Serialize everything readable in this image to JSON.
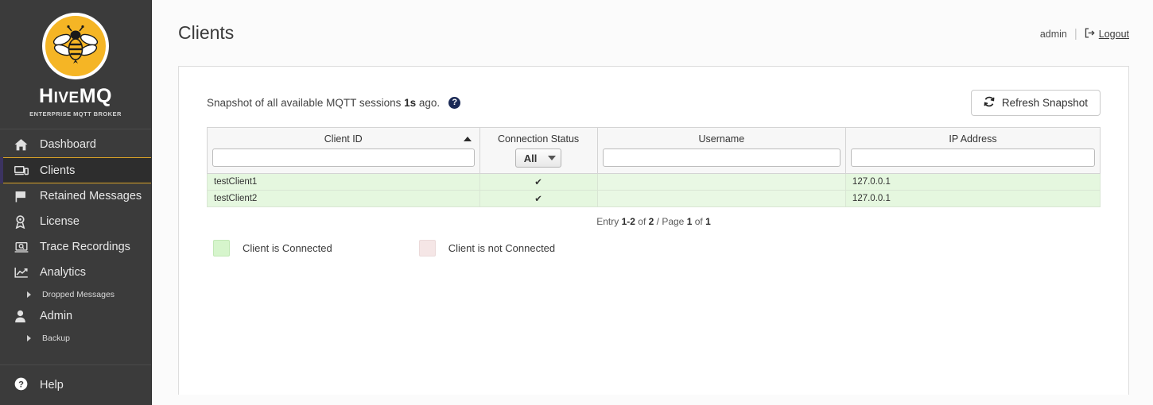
{
  "brand": {
    "logo_icon": "bee-logo-icon",
    "wordmark": "HiveMQ",
    "tagline": "ENTERPRISE MQTT BROKER",
    "logo_bg": "#f5b525"
  },
  "sidebar": {
    "items": [
      {
        "label": "Dashboard",
        "icon": "home-icon",
        "active": false
      },
      {
        "label": "Clients",
        "icon": "devices-icon",
        "active": true
      },
      {
        "label": "Retained Messages",
        "icon": "flag-icon",
        "active": false
      },
      {
        "label": "License",
        "icon": "award-icon",
        "active": false
      },
      {
        "label": "Trace Recordings",
        "icon": "laptop-search-icon",
        "active": false
      },
      {
        "label": "Analytics",
        "icon": "chart-line-icon",
        "active": false
      }
    ],
    "analytics_sub": {
      "label": "Dropped Messages",
      "icon": "caret-right-icon"
    },
    "admin": {
      "label": "Admin",
      "icon": "user-icon"
    },
    "admin_sub": {
      "label": "Backup",
      "icon": "caret-right-icon"
    },
    "help": {
      "label": "Help",
      "icon": "question-circle-icon"
    },
    "active_accent": "#d9a227"
  },
  "header": {
    "title": "Clients",
    "user": "admin",
    "divider": "|",
    "logout_label": "Logout",
    "logout_icon": "sign-out-icon"
  },
  "snapshot": {
    "text_before": "Snapshot of all available MQTT sessions ",
    "elapsed": "1s",
    "text_after": " ago.",
    "help_icon": "question-mark-icon",
    "refresh_label": "Refresh Snapshot",
    "refresh_icon": "refresh-icon"
  },
  "table": {
    "columns": [
      {
        "label": "Client ID",
        "sort": "asc",
        "filter_type": "text",
        "filter_value": ""
      },
      {
        "label": "Connection Status",
        "filter_type": "select",
        "filter_value": "All"
      },
      {
        "label": "Username",
        "filter_type": "text",
        "filter_value": ""
      },
      {
        "label": "IP Address",
        "filter_type": "text",
        "filter_value": ""
      }
    ],
    "rows": [
      {
        "client_id": "testClient1",
        "status": "✔",
        "username": "",
        "ip": "127.0.0.1",
        "connected": true
      },
      {
        "client_id": "testClient2",
        "status": "✔",
        "username": "",
        "ip": "127.0.0.1",
        "connected": true
      }
    ]
  },
  "pagination": {
    "entry_word": "Entry ",
    "entry_range": "1-2",
    "of_word": " of ",
    "total": "2",
    "page_word": " / Page ",
    "page_current": "1",
    "page_of_word": " of ",
    "page_total": "1"
  },
  "legend": {
    "connected_label": "Client is Connected",
    "connected_color": "#d6f5cc",
    "disconnected_label": "Client is not Connected",
    "disconnected_color": "#f5e6e6"
  }
}
